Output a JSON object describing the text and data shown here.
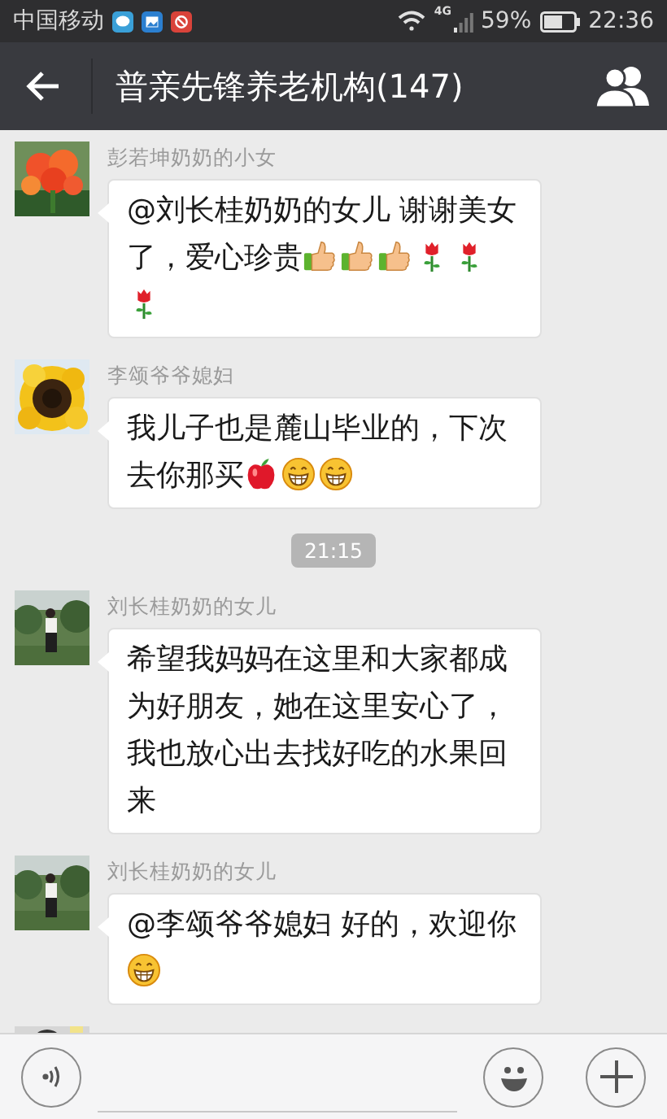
{
  "status_bar": {
    "carrier": "中国移动",
    "notifications": [
      {
        "kind": "chat"
      },
      {
        "kind": "gallery"
      },
      {
        "kind": "blocked"
      }
    ],
    "network": "4G",
    "battery": "59%",
    "time": "22:36"
  },
  "header": {
    "title": "普亲先锋养老机构(147)"
  },
  "items": [
    {
      "kind": "message",
      "sender": "彭若坤奶奶的小女",
      "avatar": {
        "kind": "picture"
      },
      "parts": [
        {
          "kind": "text",
          "text": "@刘长桂奶奶的女儿 谢谢美女"
        },
        {
          "kind": "text",
          "text": "了，爱心珍贵"
        },
        {
          "kind": "thumbs_up"
        },
        {
          "kind": "thumbs_up"
        },
        {
          "kind": "thumbs_up"
        },
        {
          "kind": "rose"
        },
        {
          "kind": "rose"
        },
        {
          "kind": "rose"
        }
      ]
    },
    {
      "kind": "message",
      "sender": "李颂爷爷媳妇",
      "avatar": {
        "kind": "picture"
      },
      "parts": [
        {
          "kind": "text",
          "text": "我儿子也是麓山毕业的，下次"
        },
        {
          "kind": "text",
          "text": "去你那买"
        },
        {
          "kind": "apple"
        },
        {
          "kind": "grin"
        },
        {
          "kind": "grin"
        }
      ]
    },
    {
      "kind": "time",
      "text": "21:15"
    },
    {
      "kind": "message",
      "sender": "刘长桂奶奶的女儿",
      "avatar": {
        "kind": "picture"
      },
      "parts": [
        {
          "kind": "text",
          "text": "希望我妈妈在这里和大家都成为好朋友，她在这里安心了，我也放心出去找好吃的水果回来"
        }
      ]
    },
    {
      "kind": "message",
      "sender": "刘长桂奶奶的女儿",
      "avatar": {
        "kind": "picture"
      },
      "parts": [
        {
          "kind": "text",
          "text": "@李颂爷爷媳妇 好的，欢迎你"
        },
        {
          "kind": "grin"
        }
      ]
    },
    {
      "kind": "partial_avatar",
      "avatar": {
        "kind": "picture"
      }
    }
  ],
  "input_bar": {
    "kind": "chat_input"
  }
}
